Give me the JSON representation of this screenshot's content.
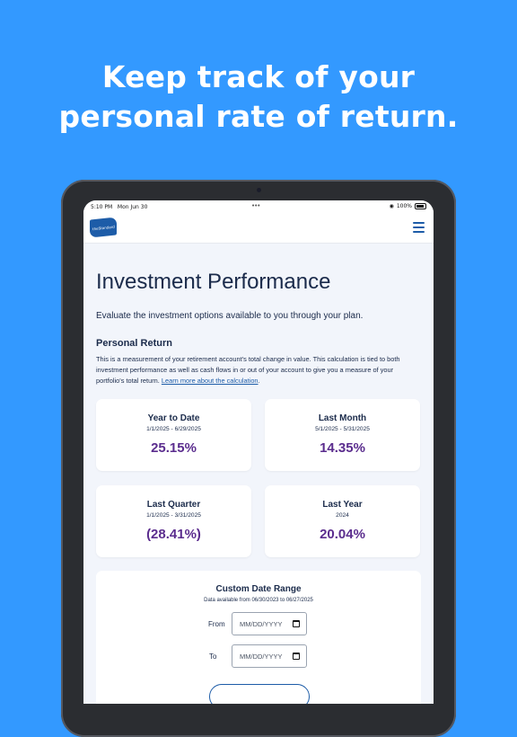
{
  "headline": [
    "Keep track of your",
    "personal rate of return."
  ],
  "status_bar": {
    "time": "5:10 PM",
    "date": "Mon Jun 30",
    "battery": "100%"
  },
  "brand": {
    "logo_text": "theStandard"
  },
  "page": {
    "title": "Investment Performance",
    "subtitle": "Evaluate the investment options available to you through your plan.",
    "section_title": "Personal Return",
    "description": "This is a measurement of your retirement account's total change in value. This calculation is tied to both investment performance as well as cash flows in or out of your account to give you a measure of your portfolio's total return. ",
    "description_link": "Learn more about the calculation",
    "description_end": "."
  },
  "cards": [
    {
      "title": "Year to Date",
      "range": "1/1/2025 - 6/29/2025",
      "value": "25.15%"
    },
    {
      "title": "Last Month",
      "range": "5/1/2025 - 5/31/2025",
      "value": "14.35%"
    },
    {
      "title": "Last Quarter",
      "range": "1/1/2025 - 3/31/2025",
      "value": "(28.41%)"
    },
    {
      "title": "Last Year",
      "range": "2024",
      "value": "20.04%"
    }
  ],
  "custom_range": {
    "title": "Custom Date Range",
    "note": "Data available from 06/30/2023 to 06/27/2025",
    "from_label": "From",
    "to_label": "To",
    "from_placeholder": "MM/DD/YYYY",
    "to_placeholder": "MM/DD/YYYY"
  },
  "colors": {
    "background": "#3399ff",
    "accent": "#1d5ca8",
    "value": "#5b2d8e"
  }
}
